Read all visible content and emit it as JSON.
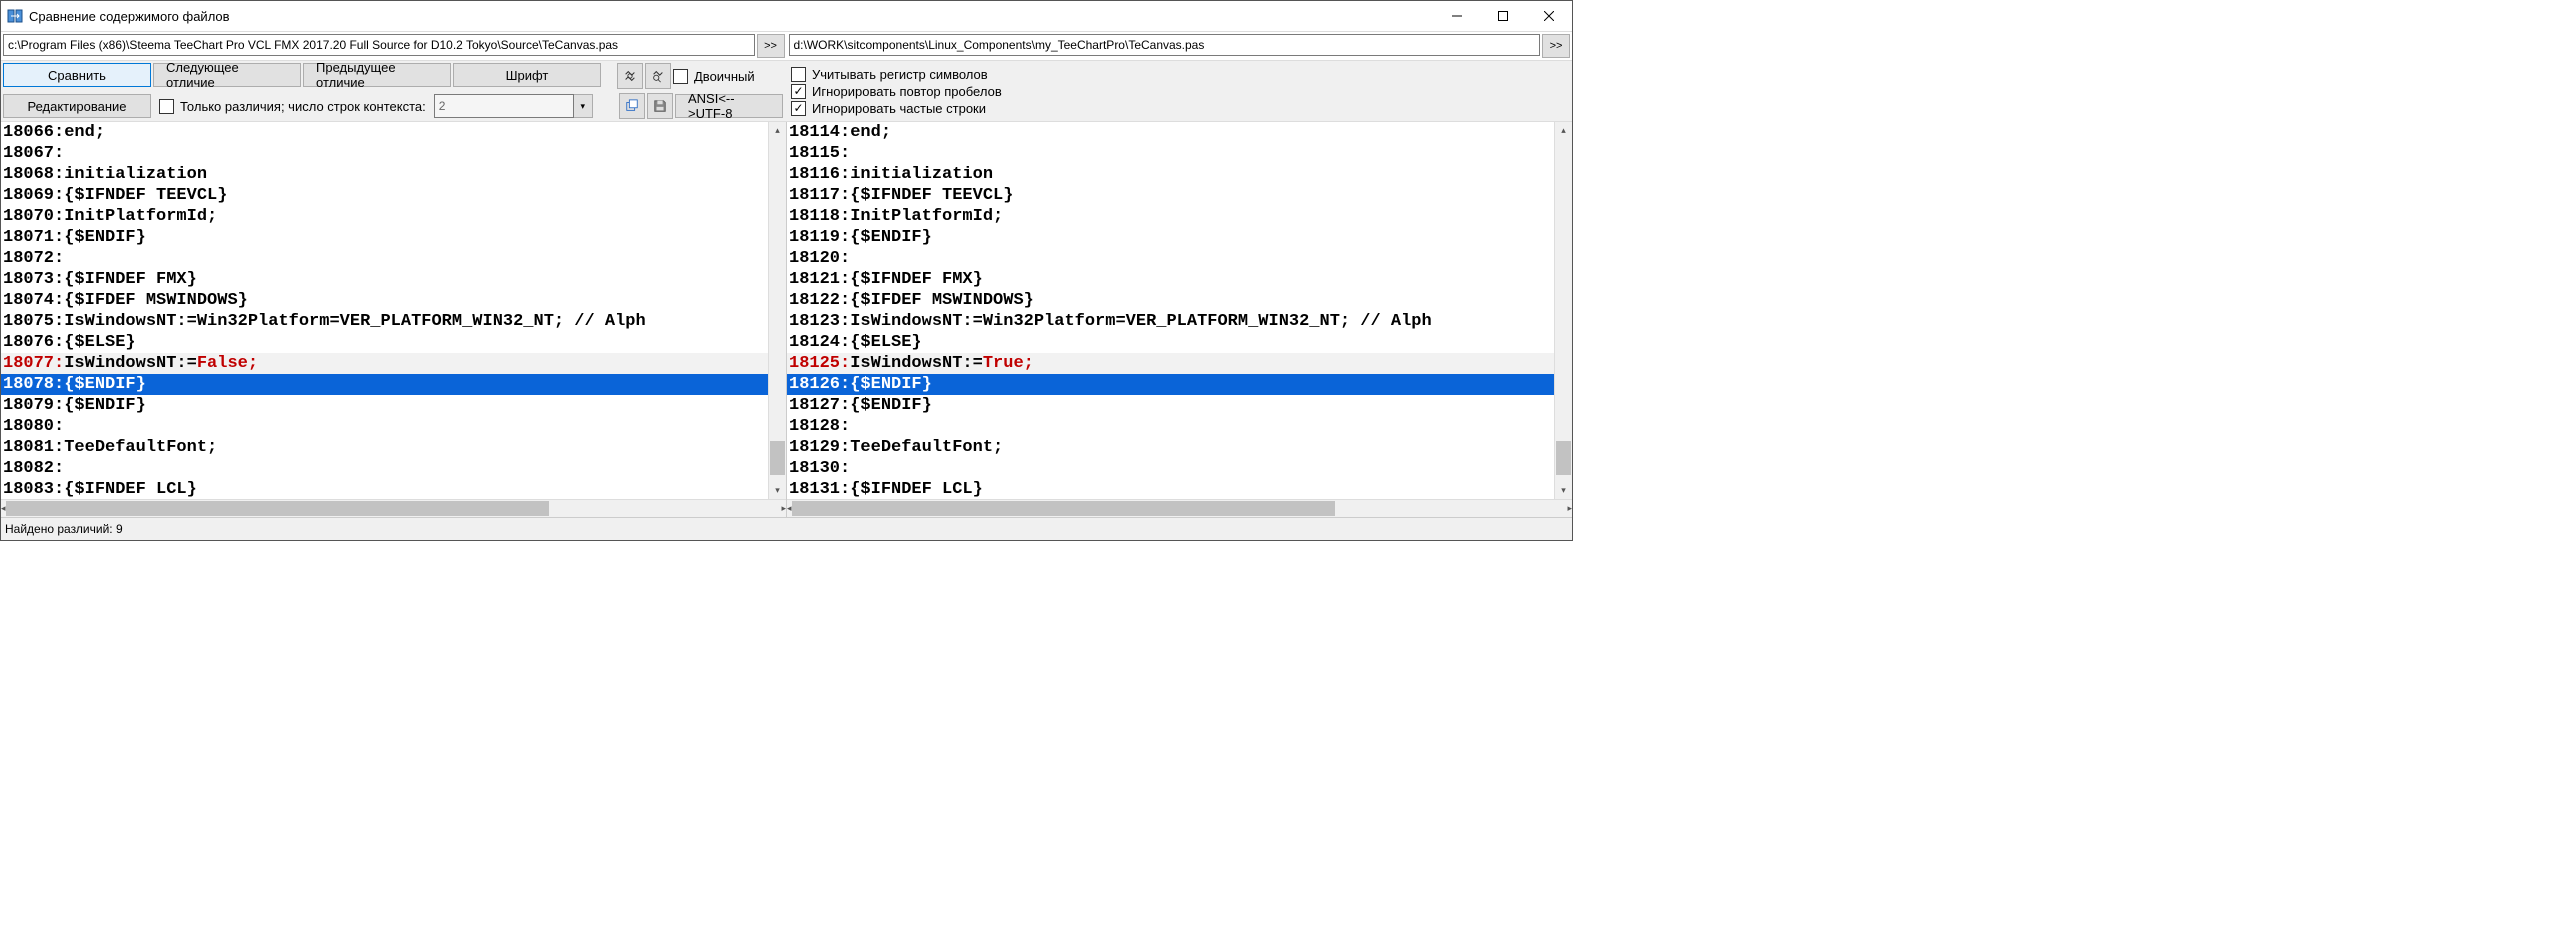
{
  "window": {
    "title": "Сравнение содержимого файлов"
  },
  "paths": {
    "left": "c:\\Program Files (x86)\\Steema TeeChart Pro VCL FMX 2017.20 Full Source for D10.2 Tokyo\\Source\\TeCanvas.pas",
    "right": "d:\\WORK\\sitcomponents\\Linux_Components\\my_TeeChartPro\\TeCanvas.pas",
    "dd": ">>"
  },
  "toolbar": {
    "compare": "Сравнить",
    "next_diff": "Следующее отличие",
    "prev_diff": "Предыдущее отличие",
    "font": "Шрифт",
    "binary": "Двоичный",
    "editing": "Редактирование",
    "only_diffs_label": "Только различия; число строк контекста:",
    "context_value": "2",
    "encoding_btn": "ANSI<-->UTF-8"
  },
  "options": {
    "case_sensitive": "Учитывать регистр символов",
    "ignore_repeat_spaces": "Игнорировать повтор пробелов",
    "ignore_frequent_lines": "Игнорировать частые строки"
  },
  "left_code": [
    {
      "n": "18066:",
      "t": "end;"
    },
    {
      "n": "18067:",
      "t": ""
    },
    {
      "n": "18068:",
      "t": "initialization"
    },
    {
      "n": "18069:",
      "t": "  {$IFNDEF TEEVCL}"
    },
    {
      "n": "18070:",
      "t": "  InitPlatformId;"
    },
    {
      "n": "18071:",
      "t": "  {$ENDIF}"
    },
    {
      "n": "18072:",
      "t": ""
    },
    {
      "n": "18073:",
      "t": "  {$IFNDEF FMX}"
    },
    {
      "n": "18074:",
      "t": "  {$IFDEF MSWINDOWS}"
    },
    {
      "n": "18075:",
      "t": "  IsWindowsNT:=Win32Platform=VER_PLATFORM_WIN32_NT;   // Alph"
    },
    {
      "n": "18076:",
      "t": "  {$ELSE}"
    },
    {
      "n": "18077:",
      "t": "  IsWindowsNT:=",
      "kw": "False;",
      "cls": "diff"
    },
    {
      "n": "18078:",
      "t": "  {$ENDIF}",
      "cls": "sel"
    },
    {
      "n": "18079:",
      "t": "  {$ENDIF}"
    },
    {
      "n": "18080:",
      "t": ""
    },
    {
      "n": "18081:",
      "t": "  TeeDefaultFont;"
    },
    {
      "n": "18082:",
      "t": ""
    },
    {
      "n": "18083:",
      "t": "  {$IFNDEF LCL}"
    }
  ],
  "right_code": [
    {
      "n": "18114:",
      "t": "end;"
    },
    {
      "n": "18115:",
      "t": ""
    },
    {
      "n": "18116:",
      "t": "initialization"
    },
    {
      "n": "18117:",
      "t": "  {$IFNDEF TEEVCL}"
    },
    {
      "n": "18118:",
      "t": "  InitPlatformId;"
    },
    {
      "n": "18119:",
      "t": "  {$ENDIF}"
    },
    {
      "n": "18120:",
      "t": ""
    },
    {
      "n": "18121:",
      "t": "  {$IFNDEF FMX}"
    },
    {
      "n": "18122:",
      "t": "  {$IFDEF MSWINDOWS}"
    },
    {
      "n": "18123:",
      "t": "  IsWindowsNT:=Win32Platform=VER_PLATFORM_WIN32_NT;   // Alph"
    },
    {
      "n": "18124:",
      "t": "  {$ELSE}"
    },
    {
      "n": "18125:",
      "t": "  IsWindowsNT:=",
      "kw": "True;",
      "cls": "diff"
    },
    {
      "n": "18126:",
      "t": "  {$ENDIF}",
      "cls": "sel"
    },
    {
      "n": "18127:",
      "t": "  {$ENDIF}"
    },
    {
      "n": "18128:",
      "t": ""
    },
    {
      "n": "18129:",
      "t": "  TeeDefaultFont;"
    },
    {
      "n": "18130:",
      "t": ""
    },
    {
      "n": "18131:",
      "t": "  {$IFNDEF LCL}"
    }
  ],
  "status": "Найдено различий: 9"
}
